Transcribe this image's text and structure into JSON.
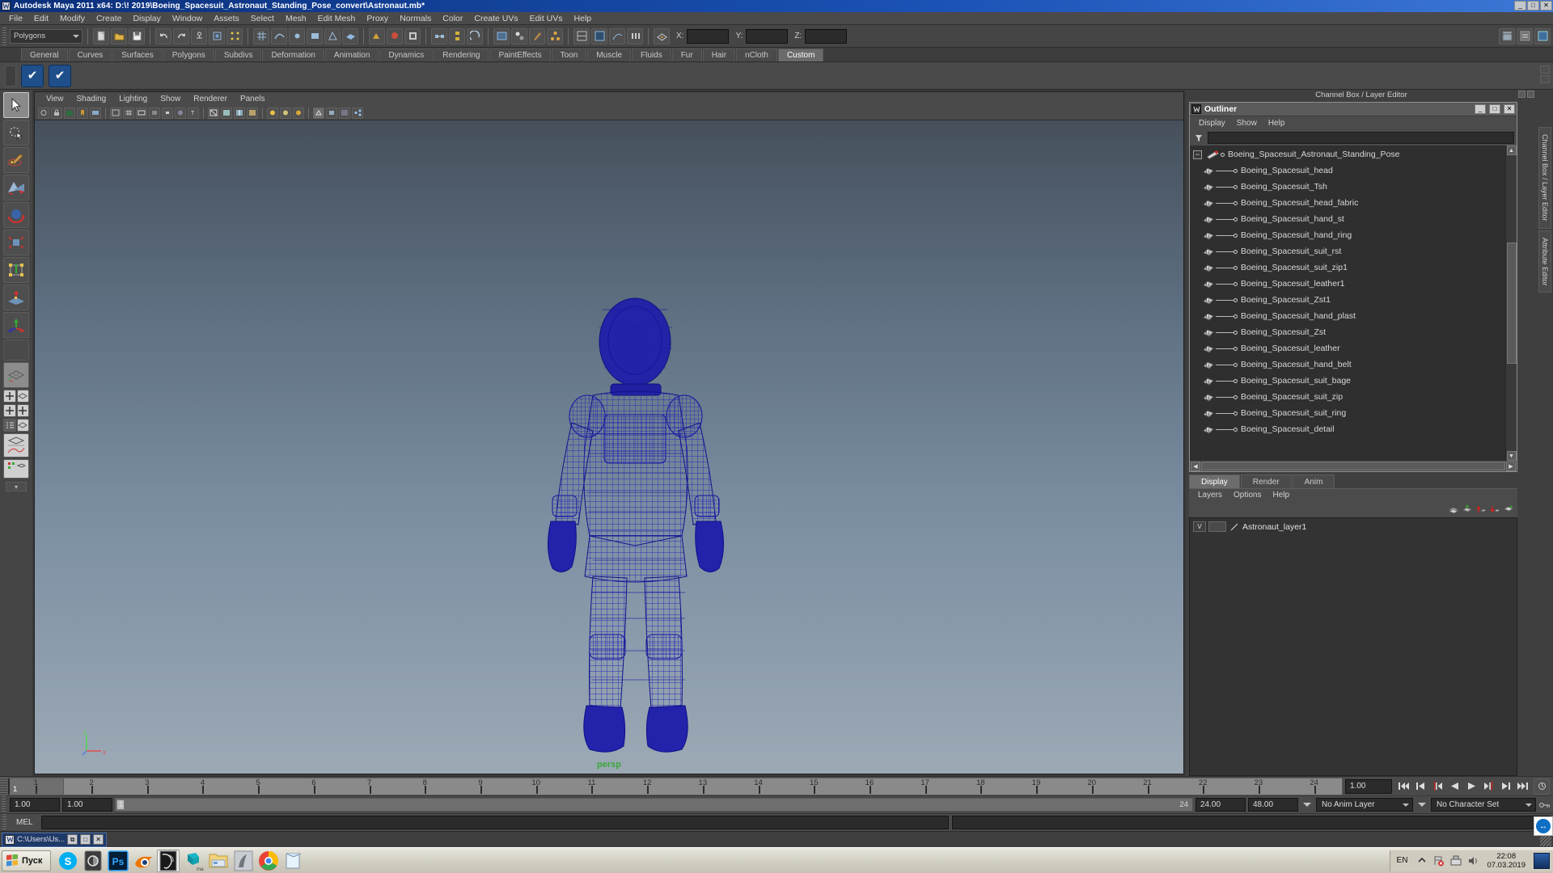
{
  "window": {
    "title": "Autodesk Maya 2011 x64: D:\\! 2019\\Boeing_Spacesuit_Astronaut_Standing_Pose_convert\\Astronaut.mb*",
    "icon": "maya-icon",
    "buttons": [
      "_",
      "□",
      "✕"
    ]
  },
  "menubar": {
    "items": [
      "File",
      "Edit",
      "Modify",
      "Create",
      "Display",
      "Window",
      "Assets",
      "Select",
      "Mesh",
      "Edit Mesh",
      "Proxy",
      "Normals",
      "Color",
      "Create UVs",
      "Edit UVs",
      "Help"
    ]
  },
  "statusline": {
    "selection_mode": "Polygons",
    "coord_labels": [
      "X:",
      "Y:",
      "Z:"
    ],
    "coord_values": [
      "",
      "",
      ""
    ]
  },
  "shelf": {
    "tabs": [
      "General",
      "Curves",
      "Surfaces",
      "Polygons",
      "Subdivs",
      "Deformation",
      "Animation",
      "Dynamics",
      "Rendering",
      "PaintEffects",
      "Toon",
      "Muscle",
      "Fluids",
      "Fur",
      "Hair",
      "nCloth",
      "Custom"
    ],
    "active_tab": "Custom",
    "buttons": [
      "check-blue-icon",
      "check-blue-icon"
    ]
  },
  "viewport": {
    "menu": [
      "View",
      "Shading",
      "Lighting",
      "Show",
      "Renderer",
      "Panels"
    ],
    "camera_label": "persp",
    "axis": {
      "y": "y",
      "x": "x",
      "z": "z"
    }
  },
  "dock": {
    "title": "Channel Box / Layer Editor",
    "vertical_tabs": [
      "Channel Box / Layer Editor",
      "Attribute Editor"
    ]
  },
  "outliner": {
    "title": "Outliner",
    "window_buttons": [
      "_",
      "□",
      "✕"
    ],
    "menu": [
      "Display",
      "Show",
      "Help"
    ],
    "root": {
      "label": "Boeing_Spacesuit_Astronaut_Standing_Pose",
      "expander": "−",
      "icon": "transform-node-icon"
    },
    "children": [
      {
        "label": "Boeing_Spacesuit_head",
        "icon": "mesh-icon"
      },
      {
        "label": "Boeing_Spacesuit_Tsh",
        "icon": "mesh-icon"
      },
      {
        "label": "Boeing_Spacesuit_head_fabric",
        "icon": "mesh-icon"
      },
      {
        "label": "Boeing_Spacesuit_hand_st",
        "icon": "mesh-icon"
      },
      {
        "label": "Boeing_Spacesuit_hand_ring",
        "icon": "mesh-icon"
      },
      {
        "label": "Boeing_Spacesuit_suit_rst",
        "icon": "mesh-icon"
      },
      {
        "label": "Boeing_Spacesuit_suit_zip1",
        "icon": "mesh-icon"
      },
      {
        "label": "Boeing_Spacesuit_leather1",
        "icon": "mesh-icon"
      },
      {
        "label": "Boeing_Spacesuit_Zst1",
        "icon": "mesh-icon"
      },
      {
        "label": "Boeing_Spacesuit_hand_plast",
        "icon": "mesh-icon"
      },
      {
        "label": "Boeing_Spacesuit_Zst",
        "icon": "mesh-icon"
      },
      {
        "label": "Boeing_Spacesuit_leather",
        "icon": "mesh-icon"
      },
      {
        "label": "Boeing_Spacesuit_hand_belt",
        "icon": "mesh-icon"
      },
      {
        "label": "Boeing_Spacesuit_suit_bage",
        "icon": "mesh-icon"
      },
      {
        "label": "Boeing_Spacesuit_suit_zip",
        "icon": "mesh-icon"
      },
      {
        "label": "Boeing_Spacesuit_suit_ring",
        "icon": "mesh-icon"
      },
      {
        "label": "Boeing_Spacesuit_detail",
        "icon": "mesh-icon"
      }
    ]
  },
  "layer_editor": {
    "tabs": [
      "Display",
      "Render",
      "Anim"
    ],
    "active_tab": "Display",
    "menu": [
      "Layers",
      "Options",
      "Help"
    ],
    "layers": [
      {
        "visibility": "V",
        "type_toggle": "",
        "name": "Astronaut_layer1"
      }
    ]
  },
  "timeslider": {
    "ticks": [
      1,
      2,
      3,
      4,
      5,
      6,
      7,
      8,
      9,
      10,
      11,
      12,
      13,
      14,
      15,
      16,
      17,
      18,
      19,
      20,
      21,
      22,
      23,
      24
    ],
    "current_frame": "1",
    "current_frame_field": "1.00",
    "playback_buttons": [
      "go-to-start-icon",
      "step-back-keyframe-icon",
      "step-back-frame-icon",
      "play-backwards-icon",
      "play-forwards-icon",
      "step-forward-frame-icon",
      "step-forward-keyframe-icon",
      "go-to-end-icon"
    ]
  },
  "rangeslider": {
    "anim_start": "1.00",
    "range_start": "1.00",
    "bar_left": "1",
    "bar_right": "24",
    "range_end": "24.00",
    "anim_end": "48.00",
    "anim_layer": "No Anim Layer",
    "character_set": "No Character Set"
  },
  "commandline": {
    "label": "MEL",
    "input": "",
    "output": ""
  },
  "taskwindow": {
    "title": "C:\\Users\\Us...",
    "icon": "maya-icon",
    "buttons": [
      "⧉",
      "□",
      "✕"
    ]
  },
  "taskbar": {
    "start_label": "Пуск",
    "quicklaunch": [
      {
        "name": "skype-icon",
        "label": "S",
        "color": "#00aff0"
      },
      {
        "name": "app-dark-icon",
        "label": "",
        "color": "#3b3b3b"
      },
      {
        "name": "photoshop-icon",
        "label": "Ps",
        "color": "#001e36"
      },
      {
        "name": "blender-icon",
        "label": "",
        "color": "#ea7600"
      },
      {
        "name": "maya-icon",
        "label": "",
        "color": "#1a1a1a"
      },
      {
        "name": "3dsmax-icon",
        "label": "max",
        "color": "#18b5c4"
      },
      {
        "name": "explorer-icon",
        "label": "",
        "color": "#f3d27a"
      },
      {
        "name": "zbrush-icon",
        "label": "",
        "color": "#c9cdd2"
      },
      {
        "name": "chrome-icon",
        "label": "",
        "color": "#4285f4"
      },
      {
        "name": "notepad-icon",
        "label": "",
        "color": "#cfe4f5"
      }
    ],
    "tray": {
      "language": "EN",
      "icons": [
        "show-hidden-icon",
        "network-error-icon",
        "safely-remove-icon",
        "volume-icon"
      ],
      "time": "22:08",
      "date": "07.03.2019"
    }
  },
  "colors": {
    "title_blue": "#1a52b5",
    "shelf_active": "#6b6b6b",
    "wireframe_blue": "#1a1aa8",
    "persp_green": "#3aa83a",
    "panel_bg": "#4a4a4a"
  }
}
